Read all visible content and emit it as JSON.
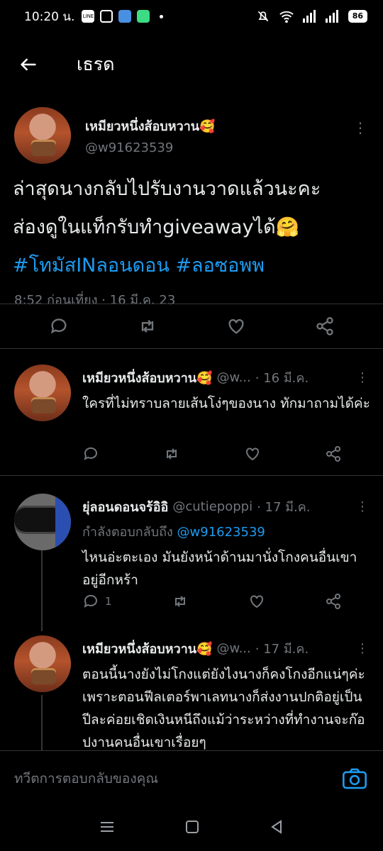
{
  "status_bar": {
    "time": "10:20 น.",
    "battery": "86",
    "app_icons": [
      "line-icon",
      "game-icon",
      "app-icon",
      "chat-icon"
    ]
  },
  "header": {
    "title": "เธรด"
  },
  "main_tweet": {
    "display_name": "เหมียวหนึ่งส้อบหวาน🥰",
    "handle": "@w91623539",
    "text_line1": "ล่าสุดนางกลับไปรับงานวาดแล้วนะคะ",
    "text_line2": "ส่องดูในแท็กรับทำgiveawayได้🤗",
    "hashtag1": "#โทมัสINลอนดอน",
    "hashtag2": "#ลอซอพพ",
    "timestamp": "8:52 ก่อนเที่ยง · 16 มี.ค. 23"
  },
  "replies": [
    {
      "display_name": "เหมียวหนึ่งส้อบหวาน🥰",
      "handle": "@w...",
      "date": "· 16 มี.ค.",
      "text": "ใครที่ไม่ทราบลายเส้นโง่ๆของนาง ทักมาถามได้ค่ะ",
      "reply_count": ""
    },
    {
      "display_name": "ยุ่ลอนดอนจร้อิอิ",
      "handle": "@cutiepoppi",
      "date": "· 17 มี.ค.",
      "replying_label": "กำลังตอบกลับถึง",
      "replying_to": "@w91623539",
      "text": "ไหนอ่ะตะเอง มันยังหน้าด้านมานั่งโกงคนอื่นเขาอยู่อีกหร้า",
      "reply_count": "1"
    },
    {
      "display_name": "เหมียวหนึ่งส้อบหวาน🥰",
      "handle": "@w...",
      "date": "· 17 มี.ค.",
      "text": "ตอนนี้นางยังไม่โกงแต่ยังไงนางก็คงโกงอีกแน่ๆค่ะ เพราะตอนฟีลเตอร์พาเลทนางก็ส่งงานปกติอยู่เป็นปีละค่อยเชิดเงินหนีถึงแม้ว่าระหว่างที่ทำงานจะก๊อปงานคนอื่นเขาเรื่อยๆ"
    }
  ],
  "compose": {
    "placeholder": "ทวีตการตอบกลับของคุณ"
  },
  "colors": {
    "accent": "#1d9bf0",
    "muted": "#71767b",
    "background": "#000000"
  }
}
